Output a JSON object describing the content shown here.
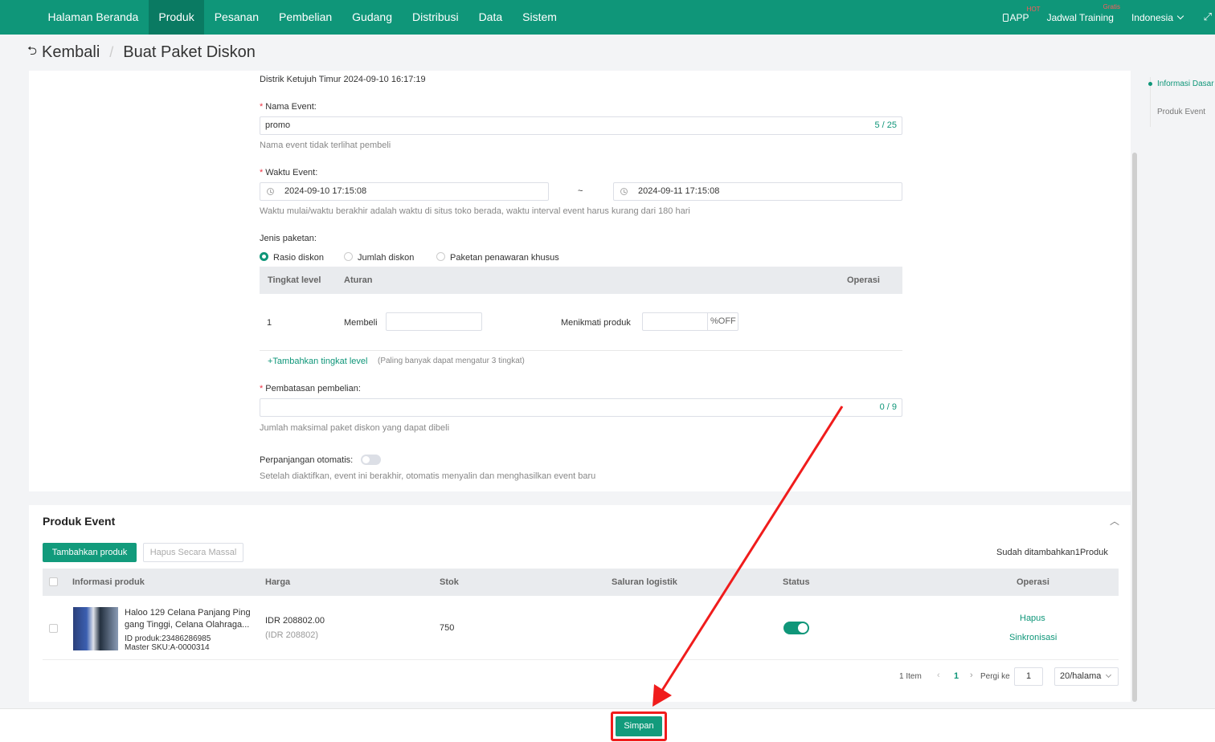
{
  "nav": {
    "items": [
      "Halaman Beranda",
      "Produk",
      "Pesanan",
      "Pembelian",
      "Gudang",
      "Distribusi",
      "Data",
      "Sistem"
    ],
    "active_index": 1,
    "app_label": "APP",
    "app_badge": "HOT",
    "training_label": "Jadwal Training",
    "training_badge": "Gratis",
    "language": "Indonesia"
  },
  "breadcrumb": {
    "back_label": "Kembali",
    "current": "Buat Paket Diskon"
  },
  "basic": {
    "timezone_line": "Distrik Ketujuh Timur 2024-09-10 16:17:19",
    "event_name_label": "Nama Event:",
    "event_name_value": "promo",
    "event_name_counter": "5 / 25",
    "event_name_hint": "Nama event tidak terlihat pembeli",
    "event_time_label": "Waktu Event:",
    "start_time": "2024-09-10 17:15:08",
    "time_separator": "~",
    "end_time": "2024-09-11 17:15:08",
    "event_time_hint": "Waktu mulai/waktu berakhir adalah waktu di situs toko berada, waktu interval event harus kurang dari 180 hari",
    "package_type_label": "Jenis paketan:",
    "package_types": [
      "Rasio diskon",
      "Jumlah diskon",
      "Paketan penawaran khusus"
    ],
    "package_type_selected": 0,
    "tier_table": {
      "headers": [
        "Tingkat level",
        "Aturan",
        "Operasi"
      ],
      "rows": [
        {
          "level": "1",
          "buy_label": "Membeli",
          "enjoy_label": "Menikmati produk",
          "unit": "%OFF"
        }
      ]
    },
    "add_tier_label": "+Tambahkan tingkat level",
    "add_tier_hint": "(Paling banyak dapat mengatur 3 tingkat)",
    "purchase_limit_label": "Pembatasan pembelian:",
    "purchase_limit_counter": "0 / 9",
    "purchase_limit_hint": "Jumlah maksimal paket diskon yang dapat dibeli",
    "auto_extend_label": "Perpanjangan otomatis:",
    "auto_extend_on": false,
    "auto_extend_hint": "Setelah diaktifkan, event ini berakhir, otomatis menyalin dan menghasilkan event baru"
  },
  "products": {
    "title": "Produk Event",
    "add_button": "Tambahkan produk",
    "bulk_delete_button": "Hapus Secara Massal",
    "added_count_text": "Sudah ditambahkan1Produk",
    "headers": [
      "Informasi produk",
      "Harga",
      "Stok",
      "Saluran logistik",
      "Status",
      "Operasi"
    ],
    "rows": [
      {
        "name_line1": "Haloo 129 Celana Panjang Ping",
        "name_line2": "gang Tinggi, Celana Olahraga...",
        "product_id": "ID produk:23486286985",
        "master_sku": "Master SKU:A-0000314",
        "price": "IDR 208802.00",
        "price_sub": "(IDR 208802)",
        "stock": "750",
        "status_on": true,
        "op_delete": "Hapus",
        "op_sync": "Sinkronisasi"
      }
    ],
    "pagination": {
      "total": "1 Item",
      "current_page": "1",
      "goto_label": "Pergi ke",
      "goto_value": "1",
      "page_size": "20/halama"
    }
  },
  "side_nav": {
    "items": [
      "Informasi Dasar",
      "Produk Event"
    ],
    "active_index": 0
  },
  "footer": {
    "save_label": "Simpan"
  },
  "colors": {
    "brand": "#0f9679",
    "annotation": "#f01c1c"
  }
}
